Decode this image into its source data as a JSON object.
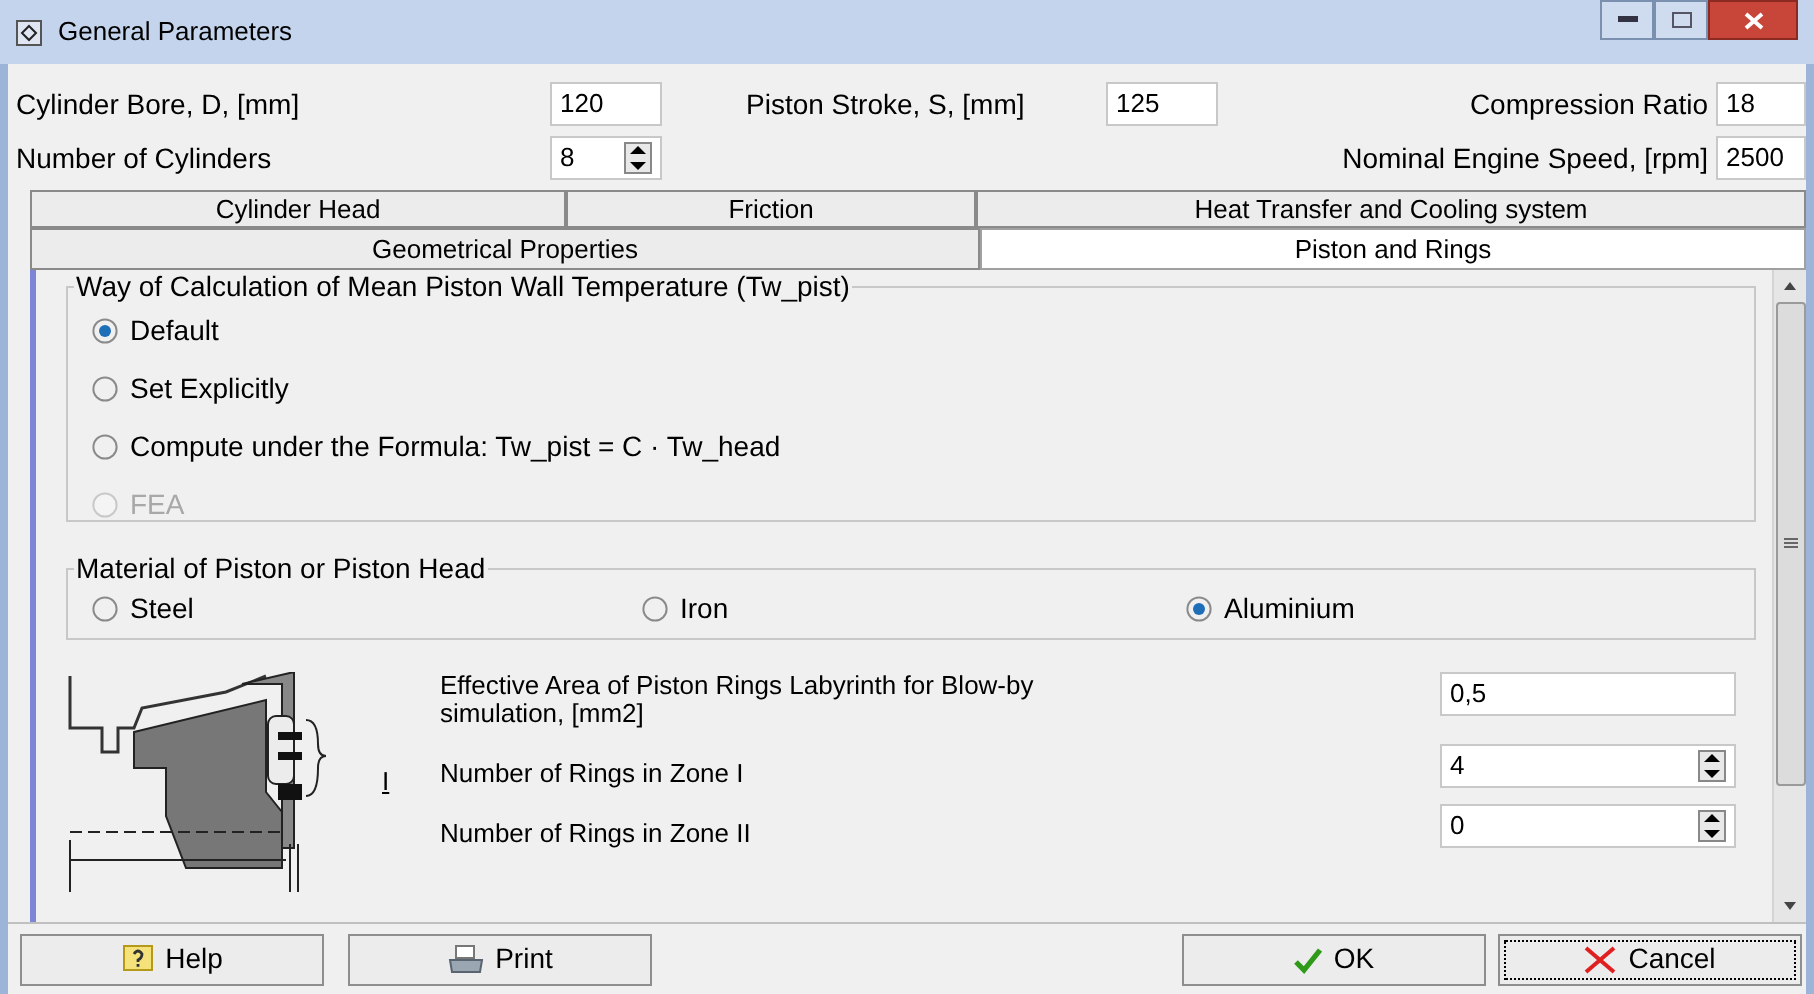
{
  "window": {
    "title": "General Parameters"
  },
  "params": [
    {
      "label": "Cylinder Bore, D, [mm]",
      "value": "120",
      "kind": "text"
    },
    {
      "label": "Piston Stroke, S, [mm]",
      "value": "125",
      "kind": "text"
    },
    {
      "label": "Compression Ratio",
      "value": "18",
      "kind": "text"
    },
    {
      "label": "Number of Cylinders",
      "value": "8",
      "kind": "spin"
    },
    {
      "label": "Nominal Engine Speed, [rpm]",
      "value": "2500",
      "kind": "text"
    }
  ],
  "tabs_row_1": [
    {
      "label": "Cylinder Head",
      "selected": false
    },
    {
      "label": "Friction",
      "selected": false
    },
    {
      "label": "Heat Transfer and Cooling system",
      "selected": false
    }
  ],
  "tabs_row_2": [
    {
      "label": "Geometrical Properties",
      "selected": false
    },
    {
      "label": "Piston and Rings",
      "selected": true
    }
  ],
  "wall_temperature": {
    "title": "Way of Calculation of Mean Piston Wall Temperature (Tw_pist)",
    "options": [
      {
        "label": "Default",
        "selected": true,
        "disabled": false
      },
      {
        "label": "Set Explicitly",
        "selected": false,
        "disabled": false
      },
      {
        "label": "Compute under the Formula: Tw_pist = C · Tw_head",
        "selected": false,
        "disabled": false
      },
      {
        "label": "FEA",
        "selected": false,
        "disabled": true
      }
    ]
  },
  "material": {
    "title": "Material of Piston or Piston Head",
    "options": [
      {
        "label": "Steel",
        "selected": false
      },
      {
        "label": "Iron",
        "selected": false
      },
      {
        "label": "Aluminium",
        "selected": true
      }
    ]
  },
  "drawing_label": "I",
  "rings": [
    {
      "label": "Effective Area of Piston Rings Labyrinth for Blow-by simulation, [mm2]",
      "value": "0,5",
      "kind": "text"
    },
    {
      "label": "Number of Rings in Zone I",
      "value": "4",
      "kind": "spin"
    },
    {
      "label": "Number of Rings in Zone II",
      "value": "0",
      "kind": "spin"
    }
  ],
  "buttons": [
    {
      "label": "Help",
      "kind": "help"
    },
    {
      "label": "Print",
      "kind": "print"
    },
    {
      "label": "OK",
      "kind": "ok"
    },
    {
      "label": "Cancel",
      "kind": "cancel",
      "focused": true
    }
  ]
}
